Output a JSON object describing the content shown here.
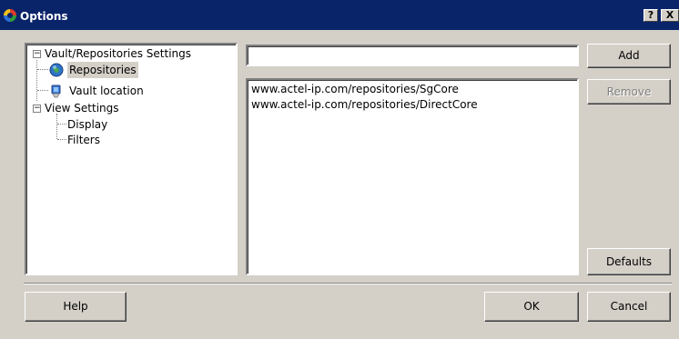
{
  "window": {
    "title": "Options",
    "help_glyph": "?",
    "close_glyph": "X"
  },
  "tree": {
    "nodes": [
      {
        "label": "Vault/Repositories Settings",
        "expander": "−",
        "icon": "none"
      },
      {
        "label": "Repositories",
        "icon": "globe-icon",
        "selected": true
      },
      {
        "label": "Vault location",
        "icon": "vault-icon"
      },
      {
        "label": "View Settings",
        "expander": "−",
        "icon": "none"
      },
      {
        "label": "Display",
        "icon": "none"
      },
      {
        "label": "Filters",
        "icon": "none"
      }
    ]
  },
  "repository": {
    "input_value": "",
    "items": [
      "www.actel-ip.com/repositories/SgCore",
      "www.actel-ip.com/repositories/DirectCore"
    ]
  },
  "buttons": {
    "add": "Add",
    "remove": "Remove",
    "defaults": "Defaults",
    "help": "Help",
    "ok": "OK",
    "cancel": "Cancel"
  },
  "colors": {
    "titlebar": "#0a246a",
    "face": "#d4d0c8",
    "disabled_text": "#808080"
  }
}
